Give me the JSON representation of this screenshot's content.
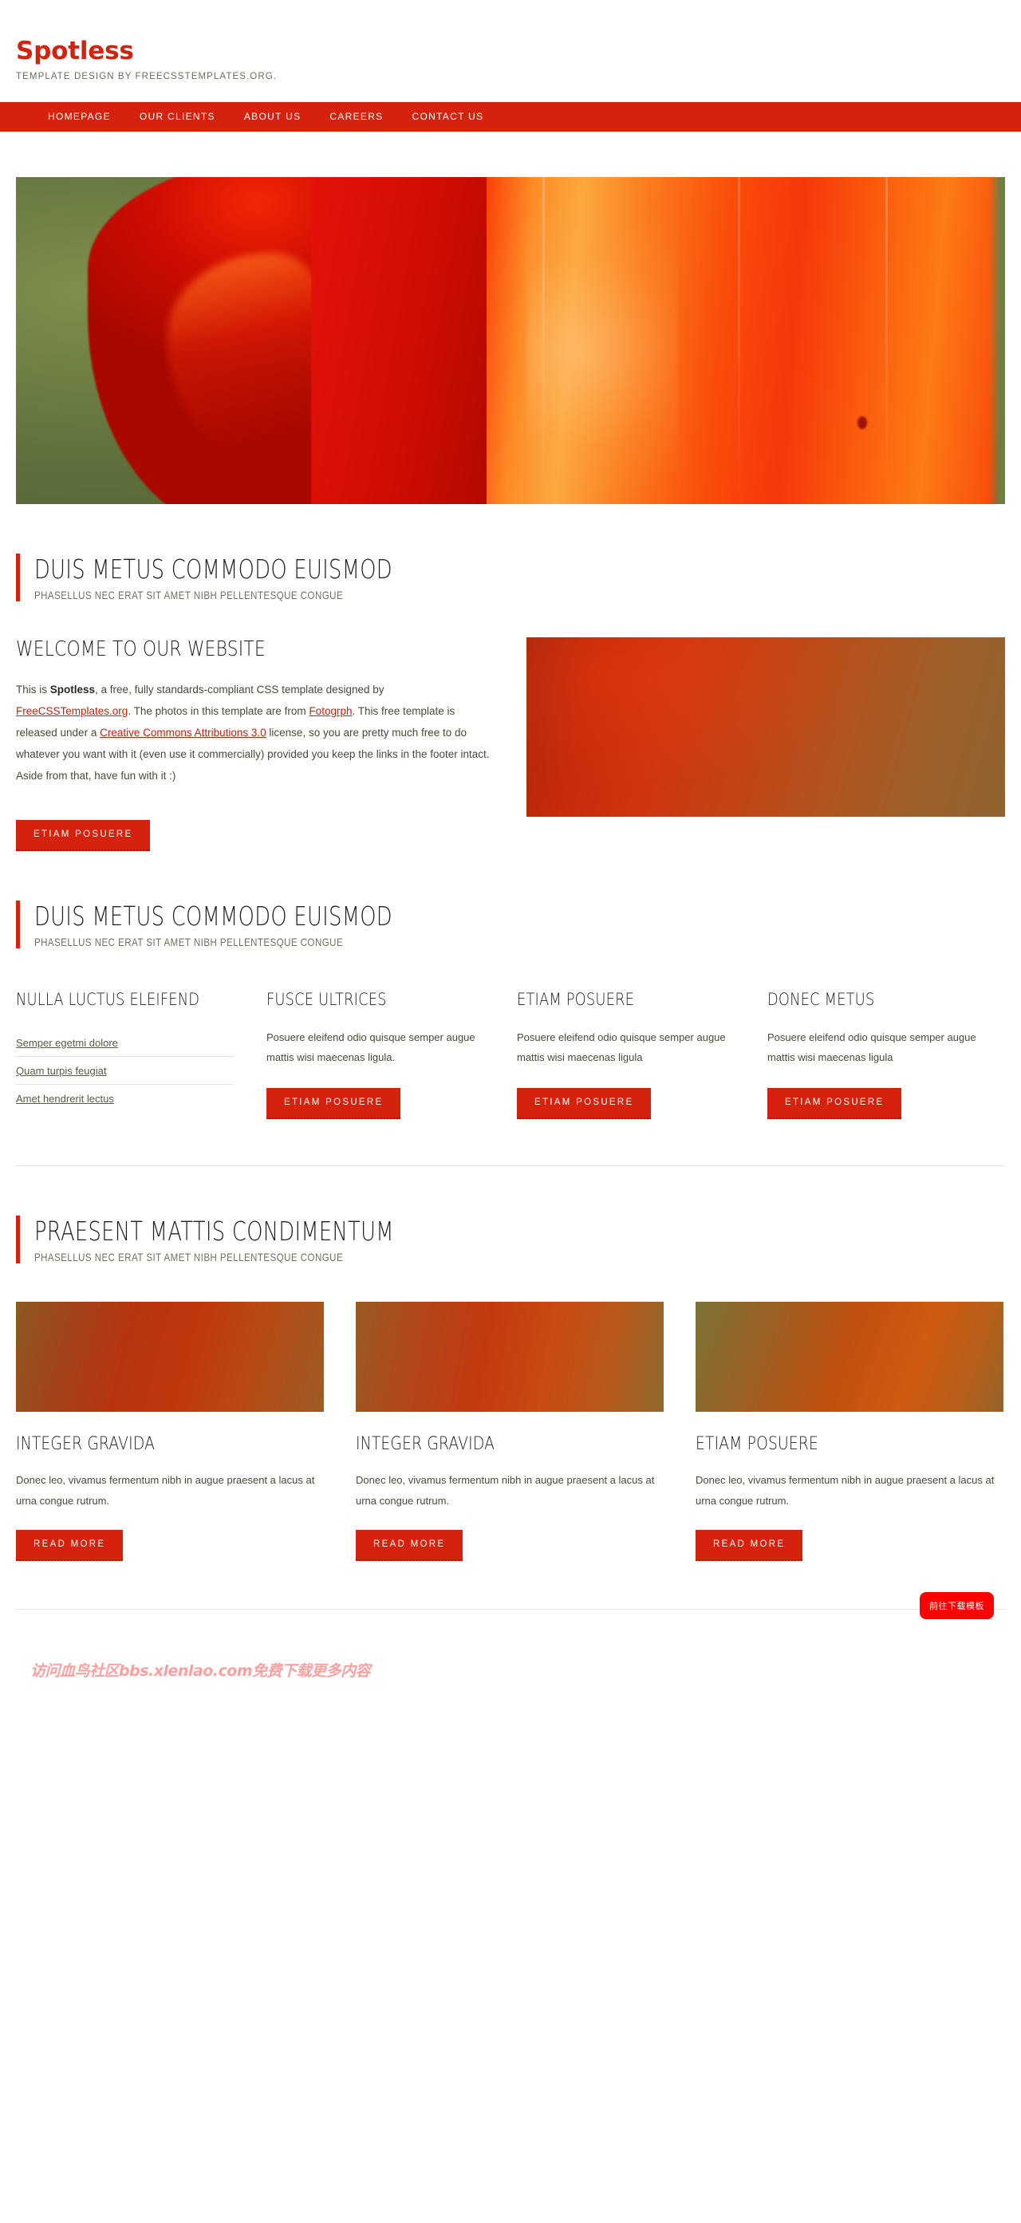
{
  "header": {
    "logo": "Spotless",
    "tagline": "Template design by FreeCSSTemplates.org."
  },
  "nav": {
    "items": [
      {
        "label": "Homepage"
      },
      {
        "label": "Our Clients"
      },
      {
        "label": "About Us"
      },
      {
        "label": "Careers"
      },
      {
        "contact": "",
        "label": "Contact Us"
      }
    ]
  },
  "banner": {
    "alt": "red-tulip-petal-photo"
  },
  "section1": {
    "title": "Duis Metus Commodo Euismod",
    "subtitle": "Phasellus nec erat sit amet nibh pellentesque congue",
    "welcome_title": "Welcome to our website",
    "paragraph_1": "This is ",
    "paragraph_bold": "Spotless",
    "paragraph_2": ", a free, fully standards-compliant CSS template designed by ",
    "link_freecss": "FreeCSSTemplates.org",
    "paragraph_3": ". The photos in this template are from ",
    "link_fotogrph": "Fotogrph",
    "paragraph_4": ". This free template is released under a ",
    "link_cc": "Creative Commons Attributions 3.0",
    "paragraph_5": " license, so you are pretty much free to do whatever you want with it (even use it commercially) provided you keep the links in the footer intact. Aside from that, have fun with it :)",
    "button": "Etiam Posuere"
  },
  "section2": {
    "title": "Duis Metus Commodo Euismod",
    "subtitle": "Phasellus nec erat sit amet nibh pellentesque congue",
    "columns": [
      {
        "heading": "Nulla Luctus Eleifend",
        "links": [
          "Semper egetmi dolore",
          "Quam turpis feugiat",
          "Amet hendrerit lectus"
        ]
      },
      {
        "heading": "Fusce Ultrices",
        "text": "Posuere eleifend odio quisque semper augue mattis wisi maecenas ligula.",
        "button": "Etiam Posuere"
      },
      {
        "heading": "Etiam Posuere",
        "text": "Posuere eleifend odio quisque semper augue mattis wisi maecenas ligula",
        "button": "Etiam Posuere"
      },
      {
        "heading": "Donec Metus",
        "text": "Posuere eleifend odio quisque semper augue mattis wisi maecenas ligula",
        "button": "Etiam Posuere"
      }
    ]
  },
  "section3": {
    "title": "Praesent Mattis Condimentum",
    "subtitle": "Phasellus nec erat sit amet nibh pellentesque congue",
    "cards": [
      {
        "heading": "Integer Gravida",
        "text": "Donec leo, vivamus fermentum nibh in augue praesent a lacus at urna congue rutrum.",
        "button": "Read More"
      },
      {
        "heading": "Integer Gravida",
        "text": "Donec leo, vivamus fermentum nibh in augue praesent a lacus at urna congue rutrum.",
        "button": "Read More"
      },
      {
        "heading": "Etiam Posuere",
        "text": "Donec leo, vivamus fermentum nibh in augue praesent a lacus at urna congue rutrum.",
        "button": "Read More"
      }
    ]
  },
  "footer": {
    "watermark": "访问血鸟社区bbs.xlenlao.com免费下载更多内容",
    "download_button": "前往下载模板"
  },
  "colors": {
    "accent": "#d6210c",
    "link": "#c4210c",
    "text": "#4a4a38",
    "heading": "#1d1d1d",
    "watermark": "#ffa0a0",
    "download_pill": "#ff0000"
  }
}
